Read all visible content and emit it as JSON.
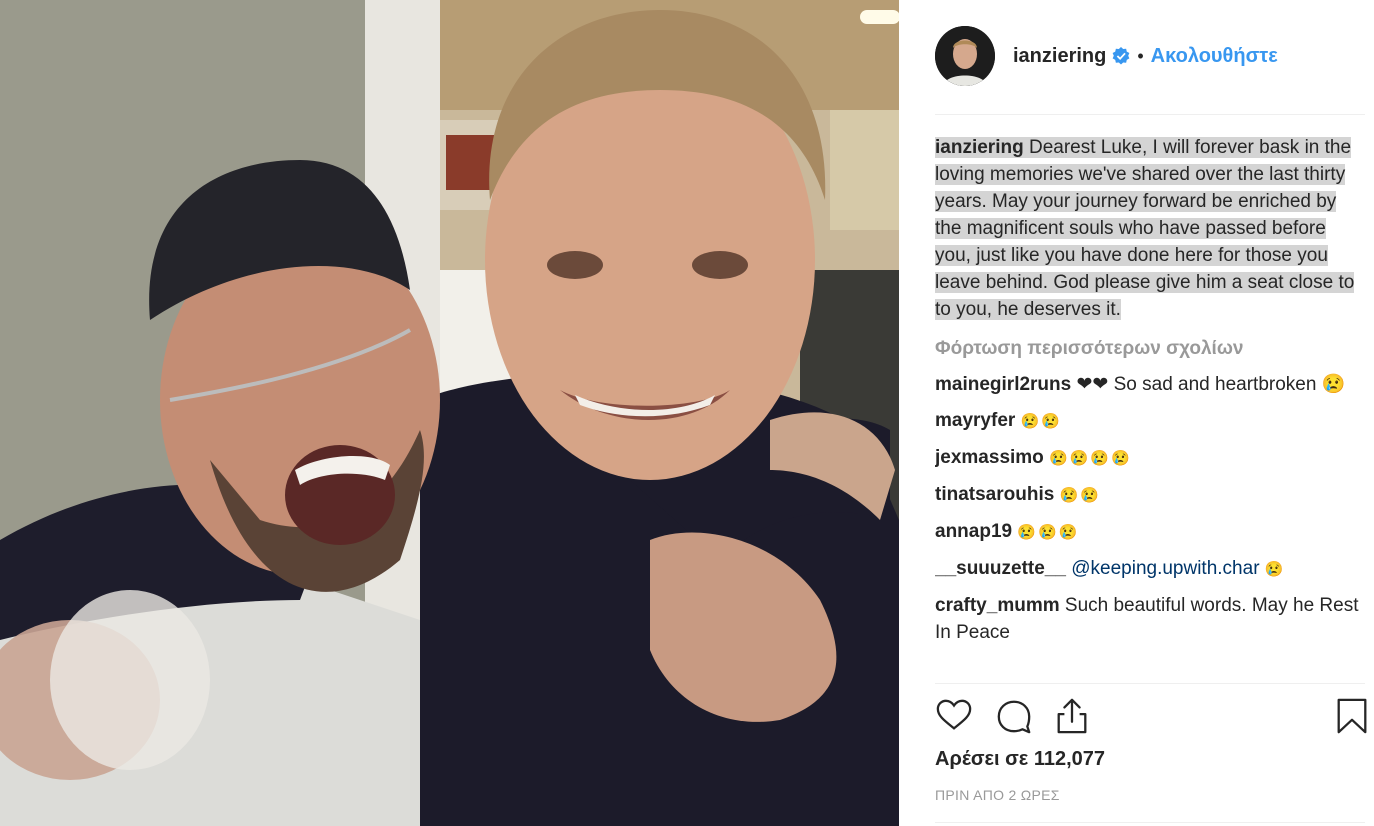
{
  "post": {
    "username": "ianziering",
    "follow_label": "Ακολουθήστε",
    "dot": "•",
    "caption": {
      "username": "ianziering",
      "text": "Dearest Luke, I will forever bask in the loving memories we've shared over the last thirty years. May your journey forward be enriched by the magnificent souls who have passed before you, just like you have done here for those you leave behind. God please give him a seat close to to you, he deserves it."
    },
    "load_more_label": "Φόρτωση περισσότερων σχολίων",
    "comments": [
      {
        "username": "mainegirl2runs",
        "text": "❤❤ So sad and heartbroken 😢"
      },
      {
        "username": "mayryfer",
        "text": "😢😢"
      },
      {
        "username": "jexmassimo",
        "text": "😢😢😢😢"
      },
      {
        "username": "tinatsarouhis",
        "text": "😢😢"
      },
      {
        "username": "annap19",
        "text": "😢😢😢"
      },
      {
        "username": "__suuuzette__",
        "mention": "@keeping.upwith.char",
        "text": "😢"
      },
      {
        "username": "crafty_mumm",
        "text": "Such beautiful words. May he Rest In Peace"
      }
    ],
    "likes_label": "Αρέσει σε 112,077",
    "time_label": "ΠΡΙΝ ΑΠΟ 2 ΩΡΕΣ"
  },
  "icons": {
    "like": "heart-icon",
    "comment": "comment-bubble-icon",
    "share": "share-icon",
    "save": "bookmark-icon",
    "verified": "verified-badge-icon"
  },
  "colors": {
    "accent": "#3897f0",
    "verified": "#3897f0",
    "muted": "#999999",
    "caption_highlight": "#d4d4d4"
  }
}
